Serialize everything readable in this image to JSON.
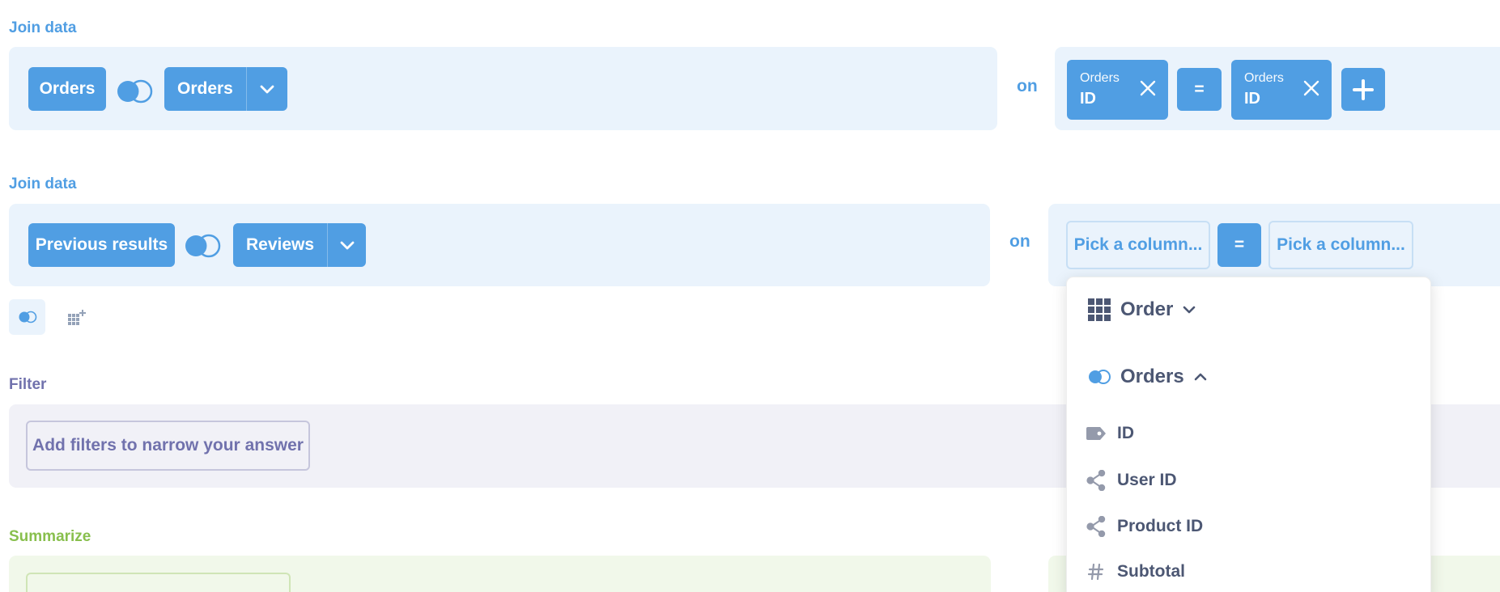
{
  "join1": {
    "label": "Join data",
    "left_table": "Orders",
    "right_table": "Orders",
    "on": "on",
    "condition": {
      "left": {
        "table": "Orders",
        "column": "ID"
      },
      "operator": "=",
      "right": {
        "table": "Orders",
        "column": "ID"
      }
    }
  },
  "join2": {
    "label": "Join data",
    "left_table": "Previous results",
    "right_table": "Reviews",
    "on": "on",
    "left_placeholder": "Pick a column...",
    "operator": "=",
    "right_placeholder": "Pick a column..."
  },
  "filter": {
    "label": "Filter",
    "placeholder": "Add filters to narrow your answer"
  },
  "summarize": {
    "label": "Summarize"
  },
  "column_picker": {
    "groups": [
      {
        "name": "Order",
        "icon": "table-grid-icon",
        "expanded": false
      },
      {
        "name": "Orders",
        "icon": "join-venn-icon",
        "expanded": true
      }
    ],
    "items": [
      {
        "label": "ID",
        "icon": "tag-icon"
      },
      {
        "label": "User ID",
        "icon": "connection-icon"
      },
      {
        "label": "Product ID",
        "icon": "connection-icon"
      },
      {
        "label": "Subtotal",
        "icon": "hash-icon"
      }
    ]
  },
  "colors": {
    "brand": "#509ee3",
    "join_bg": "#eaf3fc",
    "filter": "#7172ad",
    "filter_bg": "#f1f1f7",
    "summarize": "#88bf4d",
    "summarize_bg": "#f1f8ea",
    "text_dark": "#4c5773"
  }
}
